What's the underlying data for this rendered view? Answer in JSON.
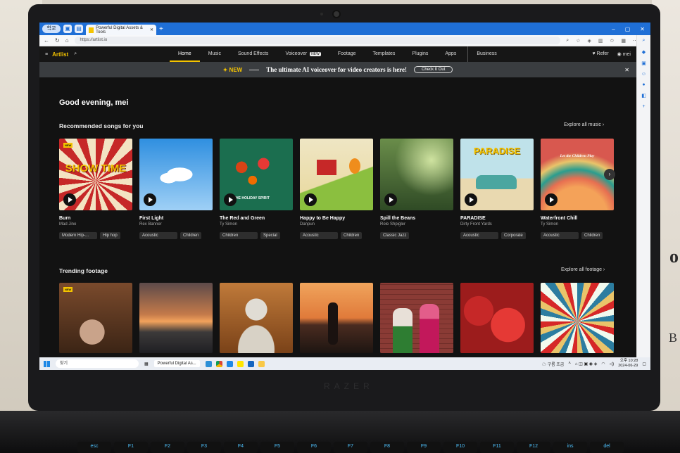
{
  "browser": {
    "profile": "학교",
    "tab_title": "Powerful Digital Assets & Tools",
    "url": "https://artlist.io",
    "new_tab": "+",
    "win_min": "–",
    "win_max": "▢",
    "win_close": "✕"
  },
  "nav": {
    "logo": "Artlist",
    "links": [
      "Home",
      "Music",
      "Sound Effects",
      "Voiceover",
      "Footage",
      "Templates",
      "Plugins",
      "Apps",
      "Business"
    ],
    "voiceover_badge": "NEW",
    "refer": "♥ Refer",
    "user": "◉ mei"
  },
  "banner": {
    "new_label": "✦ NEW",
    "message": "The ultimate AI voiceover for video creators is here!",
    "cta": "Check It Out",
    "close": "✕"
  },
  "greeting": "Good evening, mei",
  "recommended": {
    "title": "Recommended songs for you",
    "explore": "Explore all music  ›",
    "songs": [
      {
        "title": "Burn",
        "artist": "Mad Jino",
        "tags": [
          "Modern Hip-...",
          "Hip hop"
        ],
        "badge": "NEW",
        "cover_text": "SHOW TIME"
      },
      {
        "title": "First Light",
        "artist": "Rex Banner",
        "tags": [
          "Acoustic",
          "Children"
        ]
      },
      {
        "title": "The Red and Green",
        "artist": "Ty Simon",
        "tags": [
          "Children",
          "Special"
        ],
        "cover_text": "THE HOLIDAY SPIRIT"
      },
      {
        "title": "Happy to Be Happy",
        "artist": "Danpun",
        "tags": [
          "Acoustic",
          "Children"
        ]
      },
      {
        "title": "Spill the Beans",
        "artist": "Role Shpigler",
        "tags": [
          "Classic Jazz"
        ]
      },
      {
        "title": "PARADISE",
        "artist": "Dirty Front Yards",
        "tags": [
          "Acoustic",
          "Corporate"
        ],
        "cover_text": "PARADISE"
      },
      {
        "title": "Waterfront Chill",
        "artist": "Ty Simon",
        "tags": [
          "Acoustic",
          "Children"
        ],
        "cover_text": "Let the Children Play"
      }
    ]
  },
  "trending": {
    "title": "Trending footage",
    "explore": "Explore all footage  ›",
    "badge": "NEW"
  },
  "taskbar": {
    "search": "찾기",
    "active_app": "Powerful Digital As...",
    "weather": "☁ 구름 조금",
    "time": "오후 10:28",
    "date": "2024-06-29"
  },
  "device": {
    "brand": "RAZER",
    "keys": [
      "esc",
      "F1",
      "F2",
      "F3",
      "F4",
      "F5",
      "F6",
      "F7",
      "F8",
      "F9",
      "F10",
      "F11",
      "F12",
      "ins",
      "del"
    ]
  },
  "colors": {
    "accent": "#f5c400",
    "browser_blue": "#1f6fd6",
    "site_bg": "#121212"
  }
}
